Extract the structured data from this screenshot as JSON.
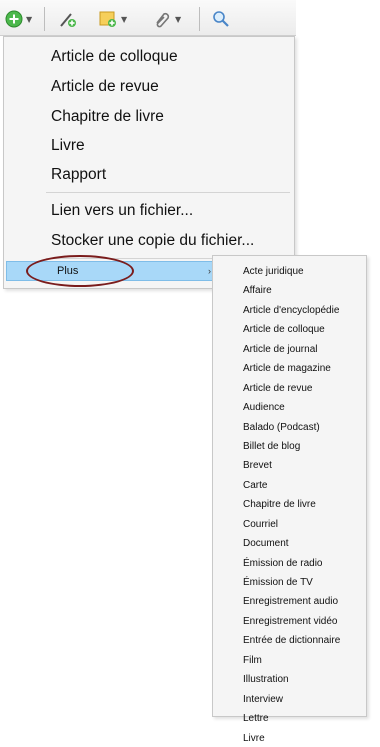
{
  "toolbar": {
    "items": [
      {
        "name": "new-item-button",
        "icon": "plus-circle-icon",
        "color": "#3aa53a"
      },
      {
        "name": "add-by-identifier-button",
        "icon": "magic-wand-icon",
        "color": "#3aa53a"
      },
      {
        "name": "new-note-button",
        "icon": "note-icon",
        "color": "#f0b030"
      },
      {
        "name": "add-attachment-button",
        "icon": "paperclip-icon",
        "color": "#7a7a7a"
      },
      {
        "name": "search-button",
        "icon": "search-icon",
        "color": "#4a86c8"
      }
    ]
  },
  "menu": {
    "items": [
      "Article de colloque",
      "Article de revue",
      "Chapitre de livre",
      "Livre",
      "Rapport"
    ],
    "file_items": [
      "Lien vers un fichier...",
      "Stocker une copie du fichier..."
    ],
    "more_label": "Plus",
    "more_arrow": "›"
  },
  "submenu": {
    "items": [
      "Acte juridique",
      "Affaire",
      "Article d'encyclopédie",
      "Article de colloque",
      "Article de journal",
      "Article de magazine",
      "Article de revue",
      "Audience",
      "Balado (Podcast)",
      "Billet de blog",
      "Brevet",
      "Carte",
      "Chapitre de livre",
      "Courriel",
      "Document",
      "Émission de radio",
      "Émission de TV",
      "Enregistrement audio",
      "Enregistrement vidéo",
      "Entrée de dictionnaire",
      "Film",
      "Illustration",
      "Interview",
      "Lettre",
      "Livre"
    ]
  },
  "colors": {
    "highlight": "#a8d8f8",
    "annotation_ellipse": "#7a1c1c"
  }
}
